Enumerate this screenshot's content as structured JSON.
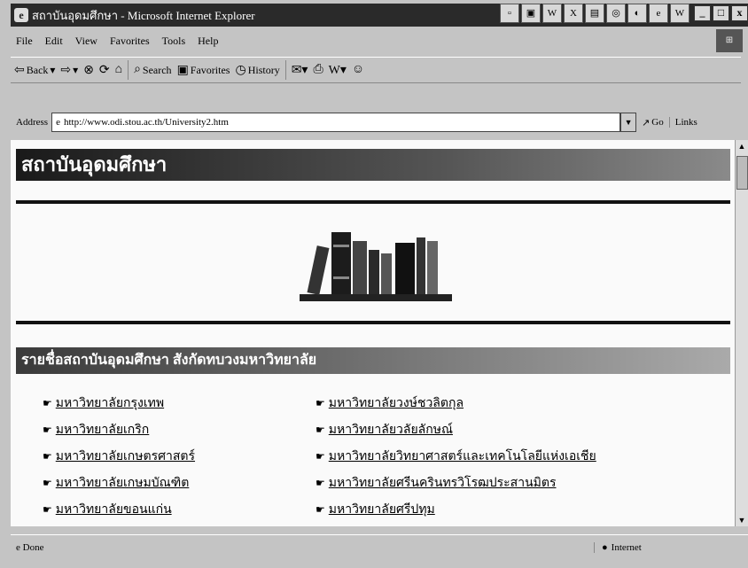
{
  "window": {
    "title": "สถาบันอุดมศึกษา - Microsoft Internet Explorer"
  },
  "menu": [
    "File",
    "Edit",
    "View",
    "Favorites",
    "Tools",
    "Help"
  ],
  "toolbar": {
    "back": "Back",
    "search": "Search",
    "favorites": "Favorites",
    "history": "History"
  },
  "address": {
    "label": "Address",
    "url": "http://www.odi.stou.ac.th/University2.htm",
    "go": "Go",
    "links": "Links"
  },
  "page": {
    "banner_title": "สถาบันอุดมศึกษา",
    "section_title": "รายชื่อสถาบันอุดมศึกษา สังกัดทบวงมหาวิทยาลัย",
    "universities_left": [
      "มหาวิทยาลัยกรุงเทพ",
      "มหาวิทยาลัยเกริก",
      "มหาวิทยาลัยเกษตรศาสตร์",
      "มหาวิทยาลัยเกษมบัณฑิต",
      "มหาวิทยาลัยขอนแก่น"
    ],
    "universities_right": [
      "มหาวิทยาลัยวงษ์ชวลิตกุล",
      "มหาวิทยาลัยวลัยลักษณ์",
      "มหาวิทยาลัยวิทยาศาสตร์และเทคโนโลยีแห่งเอเชีย",
      "มหาวิทยาลัยศรีนครินทรวิโรฒประสานมิตร",
      "มหาวิทยาลัยศรีปทุม"
    ]
  },
  "status": {
    "text": "Done",
    "zone": "Internet"
  }
}
